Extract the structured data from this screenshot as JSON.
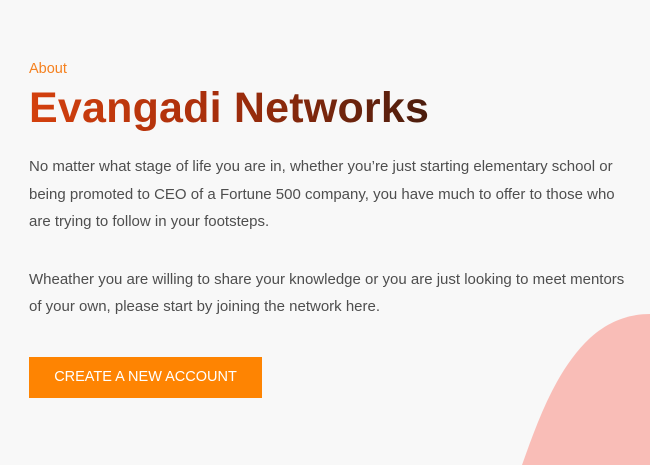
{
  "about": {
    "eyebrow": "About",
    "title": "Evangadi Networks",
    "paragraphs": [
      "No matter what stage of life you are in, whether you’re just starting elementary school or being promoted to CEO of a Fortune 500 company, you have much to offer to those who are trying to follow in your footsteps.",
      "Wheather you are willing to share your knowledge or you are just looking to meet mentors of your own, please start by joining the network here."
    ],
    "cta_label": "CREATE A NEW ACCOUNT"
  },
  "colors": {
    "eyebrow": "#f5811f",
    "title_gradient_start": "#d4400d",
    "title_gradient_end": "#4b1d0d",
    "button_bg": "#fe8402",
    "background_shape": "#f9bdb7",
    "page_bg": "#f8f8f8"
  }
}
